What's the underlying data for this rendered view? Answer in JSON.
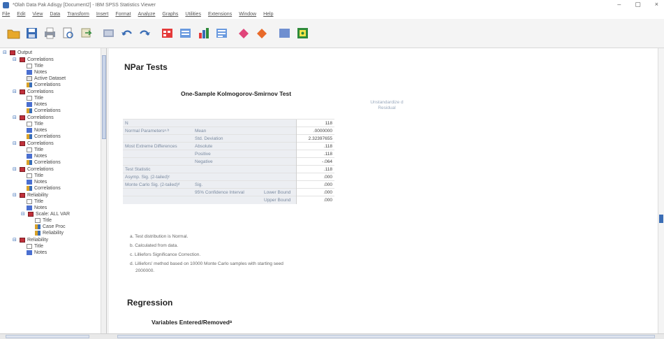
{
  "window": {
    "title": "*Olah Data Pak Adisgy [Document2] - IBM SPSS Statistics Viewer",
    "minimize_label": "–",
    "restore_label": "▢",
    "close_label": "×"
  },
  "menu": [
    "File",
    "Edit",
    "View",
    "Data",
    "Transform",
    "Insert",
    "Format",
    "Analyze",
    "Graphs",
    "Utilities",
    "Extensions",
    "Window",
    "Help"
  ],
  "toolbar_icons": [
    "open-icon",
    "save-icon",
    "print-icon",
    "print-preview-icon",
    "export-icon",
    "recall-dialog-icon",
    "undo-icon",
    "redo-icon",
    "goto-data-icon",
    "goto-case-icon",
    "variables-icon",
    "chart-icon",
    "show-all-icon",
    "insert-output-icon",
    "select-icon",
    "designate-window-icon"
  ],
  "nav": {
    "root": "Output",
    "groups": [
      {
        "name": "Correlations",
        "children": [
          "Title",
          "Notes",
          "Active Dataset",
          "Correlations"
        ]
      },
      {
        "name": "Correlations",
        "children": [
          "Title",
          "Notes",
          "Correlations"
        ]
      },
      {
        "name": "Correlations",
        "children": [
          "Title",
          "Notes",
          "Correlations"
        ]
      },
      {
        "name": "Correlations",
        "children": [
          "Title",
          "Notes",
          "Correlations"
        ]
      },
      {
        "name": "Correlations",
        "children": [
          "Title",
          "Notes",
          "Correlations"
        ]
      },
      {
        "name": "Reliability",
        "children": [
          "Title",
          "Notes"
        ],
        "sub": {
          "name": "Scale: ALL VAR",
          "children": [
            "Title",
            "Case Proc",
            "Reliability"
          ]
        }
      },
      {
        "name": "Reliability",
        "children": [
          "Title",
          "Notes"
        ]
      }
    ]
  },
  "content": {
    "section1": "NPar Tests",
    "table_title": "One-Sample Kolmogorov-Smirnov Test",
    "column_header": "Unstandardize d Residual",
    "rows": [
      [
        "N",
        "",
        "",
        "118"
      ],
      [
        "Normal Parametersᵃ·ᵇ",
        "Mean",
        "",
        ".0000000"
      ],
      [
        "",
        "Std. Deviation",
        "",
        "2.32397655"
      ],
      [
        "Most Extreme Differences",
        "Absolute",
        "",
        ".118"
      ],
      [
        "",
        "Positive",
        "",
        ".118"
      ],
      [
        "",
        "Negative",
        "",
        "-.064"
      ],
      [
        "Test Statistic",
        "",
        "",
        ".118"
      ],
      [
        "Asymp. Sig. (2-tailed)ᶜ",
        "",
        "",
        ".000"
      ],
      [
        "Monte Carlo Sig. (2-tailed)ᵈ",
        "Sig.",
        "",
        ".000"
      ],
      [
        "",
        "95% Confidence Interval",
        "Lower Bound",
        ".000"
      ],
      [
        "",
        "",
        "Upper Bound",
        ".000"
      ]
    ],
    "footnotes": [
      "a. Test distribution is Normal.",
      "b. Calculated from data.",
      "c. Lilliefors Significance Correction.",
      "d. Lilliefors' method based on 10000 Monte Carlo samples with starting seed",
      "2000000."
    ],
    "section2": "Regression",
    "table2_title": "Variables Entered/Removedᵃ"
  }
}
